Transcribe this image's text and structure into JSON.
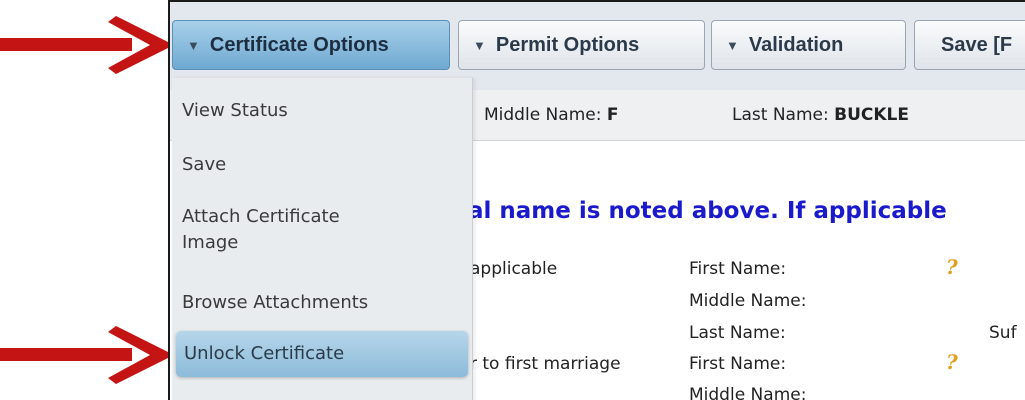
{
  "toolbar": {
    "certificate_options": "Certificate Options",
    "permit_options": "Permit Options",
    "validation": "Validation",
    "save": "Save [F"
  },
  "name_row": {
    "middle_label": "Middle Name:",
    "middle_value": "F",
    "last_label": "Last Name:",
    "last_value": "BUCKLE"
  },
  "menu": {
    "items": [
      "View Status",
      "Save",
      "Attach Certificate",
      "Image",
      "Browse Attachments",
      "Unlock Certificate"
    ]
  },
  "content": {
    "notice": "al name is noted above. If applicable",
    "row1_left": "applicable",
    "row1_first": "First Name:",
    "row1_middle": "Middle Name:",
    "row1_last": "Last Name:",
    "suffix": "Suf",
    "row2_left": "r to first marriage",
    "row2_first": "First Name:",
    "row2_middle": "Middle Name:",
    "help_icon": "?"
  },
  "annotations": {
    "arrow_color": "#c41414"
  }
}
